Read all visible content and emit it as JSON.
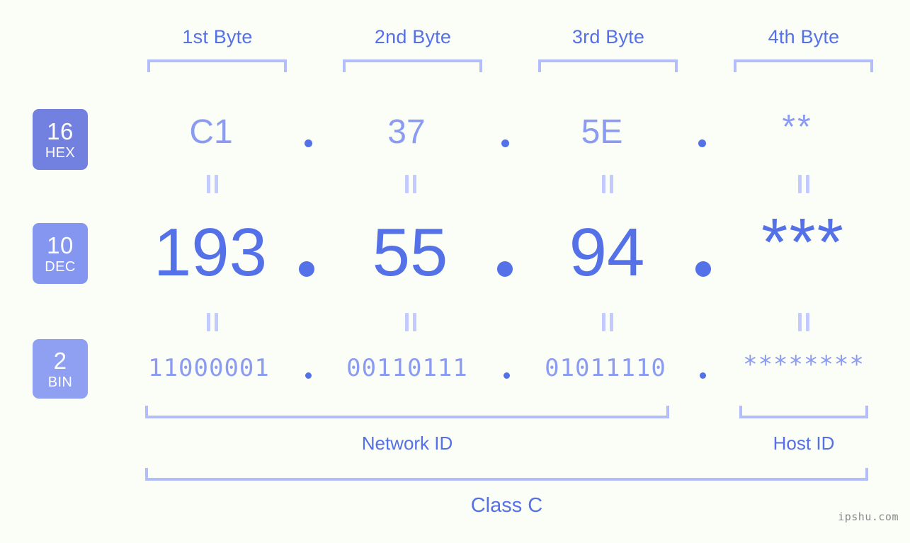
{
  "page": {
    "background_color": "#fbfdf7",
    "accent_color": "#5571e8",
    "light_accent_color": "#8b9bf2",
    "bracket_color": "#b3bdfa",
    "watermark": "ipshu.com"
  },
  "headers": [
    {
      "label": "1st Byte"
    },
    {
      "label": "2nd Byte"
    },
    {
      "label": "3rd Byte"
    },
    {
      "label": "4th Byte"
    }
  ],
  "rows": [
    {
      "badge_number": "16",
      "badge_name": "HEX",
      "badge_color": "#7281e0",
      "values": [
        "C1",
        "37",
        "5E",
        "**"
      ],
      "separator": "."
    },
    {
      "badge_number": "10",
      "badge_name": "DEC",
      "badge_color": "#8496ef",
      "values": [
        "193",
        "55",
        "94",
        "***"
      ],
      "separator": "."
    },
    {
      "badge_number": "2",
      "badge_name": "BIN",
      "badge_color": "#8fa0f2",
      "values": [
        "11000001",
        "00110111",
        "01011110",
        "********"
      ],
      "separator": "."
    }
  ],
  "equals_symbol": "=",
  "sections": [
    {
      "label": "Network ID"
    },
    {
      "label": "Host ID"
    }
  ],
  "class": {
    "label": "Class C"
  }
}
